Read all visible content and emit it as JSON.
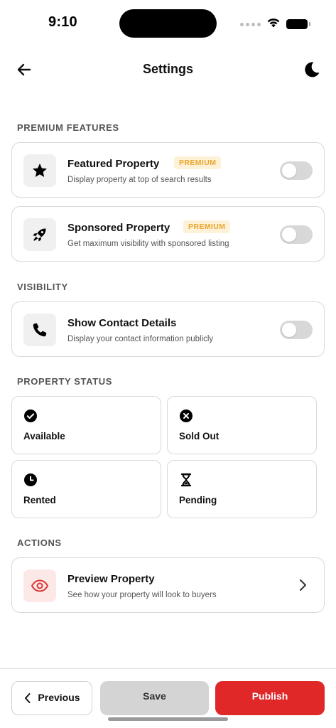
{
  "status_bar": {
    "time": "9:10"
  },
  "header": {
    "title": "Settings",
    "back_icon": "arrow-left-icon",
    "theme_icon": "moon-icon"
  },
  "sections": {
    "premium": "PREMIUM FEATURES",
    "visibility": "VISIBILITY",
    "status": "PROPERTY STATUS",
    "actions": "ACTIONS"
  },
  "premium_features": [
    {
      "title": "Featured Property",
      "badge": "PREMIUM",
      "subtitle": "Display property at top of search results",
      "icon": "star-icon",
      "enabled": false
    },
    {
      "title": "Sponsored Property",
      "badge": "PREMIUM",
      "subtitle": "Get maximum visibility with sponsored listing",
      "icon": "rocket-icon",
      "enabled": false
    }
  ],
  "visibility": {
    "title": "Show Contact Details",
    "subtitle": "Display your contact information publicly",
    "icon": "phone-icon",
    "enabled": false
  },
  "property_status": [
    {
      "label": "Available",
      "icon": "check-circle-icon"
    },
    {
      "label": "Sold Out",
      "icon": "x-circle-icon"
    },
    {
      "label": "Rented",
      "icon": "clock-icon"
    },
    {
      "label": "Pending",
      "icon": "hourglass-icon"
    }
  ],
  "actions": {
    "title": "Preview Property",
    "subtitle": "See how your property will look to buyers",
    "icon": "eye-icon"
  },
  "bottom_bar": {
    "previous": "Previous",
    "save": "Save",
    "publish": "Publish"
  },
  "colors": {
    "accent": "#e02828",
    "premium_badge_bg": "#fdf1d8",
    "premium_badge_text": "#e9a62b",
    "toggle_off": "#d8d8d8"
  }
}
